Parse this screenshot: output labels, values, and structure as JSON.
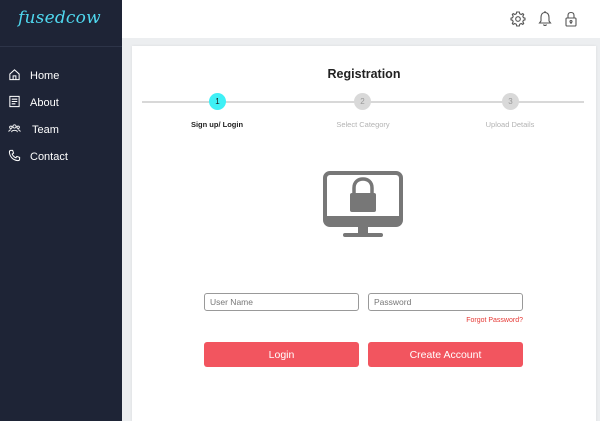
{
  "brand": {
    "name": "fusedcow"
  },
  "sidebar": {
    "items": [
      {
        "label": "Home",
        "icon": "home-icon"
      },
      {
        "label": "About",
        "icon": "document-icon"
      },
      {
        "label": "Team",
        "icon": "team-icon"
      },
      {
        "label": "Contact",
        "icon": "phone-icon"
      }
    ]
  },
  "header": {
    "icons": [
      "gear-icon",
      "bell-icon",
      "lock-icon"
    ]
  },
  "registration": {
    "title": "Registration",
    "steps": [
      {
        "number": "1",
        "label": "Sign up/ Login",
        "active": true
      },
      {
        "number": "2",
        "label": "Select Category",
        "active": false
      },
      {
        "number": "3",
        "label": "Upload Details",
        "active": false
      }
    ],
    "username_placeholder": "User Name",
    "password_placeholder": "Password",
    "forgot_label": "Forgot Password?",
    "login_label": "Login",
    "create_label": "Create Account"
  },
  "colors": {
    "sidebar_bg": "#1e2436",
    "brand": "#4fd7ee",
    "active_step": "#3ff0f6",
    "button": "#f2555f",
    "link": "#e53935"
  }
}
